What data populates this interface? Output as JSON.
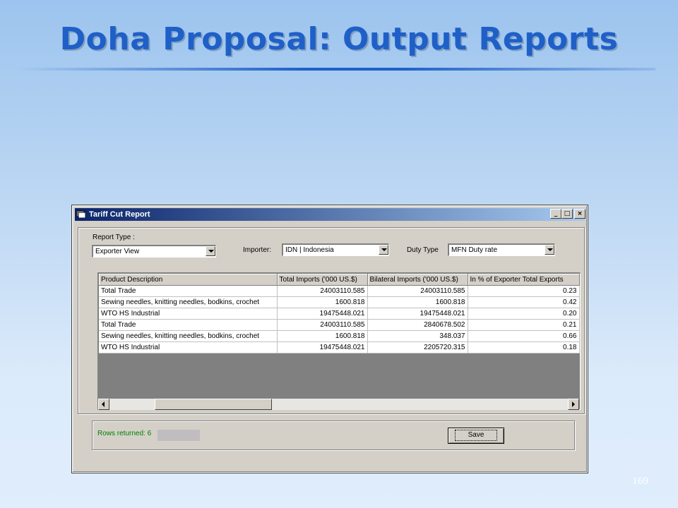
{
  "slide": {
    "title": "Doha Proposal: Output Reports",
    "page_number": "169"
  },
  "window": {
    "title": "Tariff Cut Report",
    "buttons": {
      "minimize": "_",
      "maximize": "□",
      "close": "×"
    }
  },
  "filters": {
    "report_type_label": "Report Type :",
    "report_type_value": "Exporter View",
    "importer_label": "Importer:",
    "importer_value": "IDN | Indonesia",
    "duty_type_label": "Duty Type",
    "duty_type_value": "MFN Duty rate"
  },
  "table": {
    "columns": [
      "Product Description",
      "Total Imports ('000 US.$)",
      "Bilateral Imports ('000 US.$)",
      "In % of Exporter Total Exports"
    ],
    "rows": [
      [
        "Total Trade",
        "24003110.585",
        "24003110.585",
        "0.23"
      ],
      [
        "Sewing needles, knitting needles, bodkins, crochet",
        "1600.818",
        "1600.818",
        "0.42"
      ],
      [
        "WTO HS Industrial",
        "19475448.021",
        "19475448.021",
        "0.20"
      ],
      [
        "Total Trade",
        "24003110.585",
        "2840678.502",
        "0.21"
      ],
      [
        "Sewing needles, knitting needles, bodkins, crochet",
        "1600.818",
        "348.037",
        "0.66"
      ],
      [
        "WTO HS Industrial",
        "19475448.021",
        "2205720.315",
        "0.18"
      ]
    ]
  },
  "footer": {
    "rows_returned": "Rows returned: 6",
    "save_label": "Save"
  },
  "colors": {
    "title_blue": "#1f5fc8",
    "titlebar_start": "#0a246a",
    "titlebar_end": "#a6caf0",
    "status_green": "#008000"
  }
}
